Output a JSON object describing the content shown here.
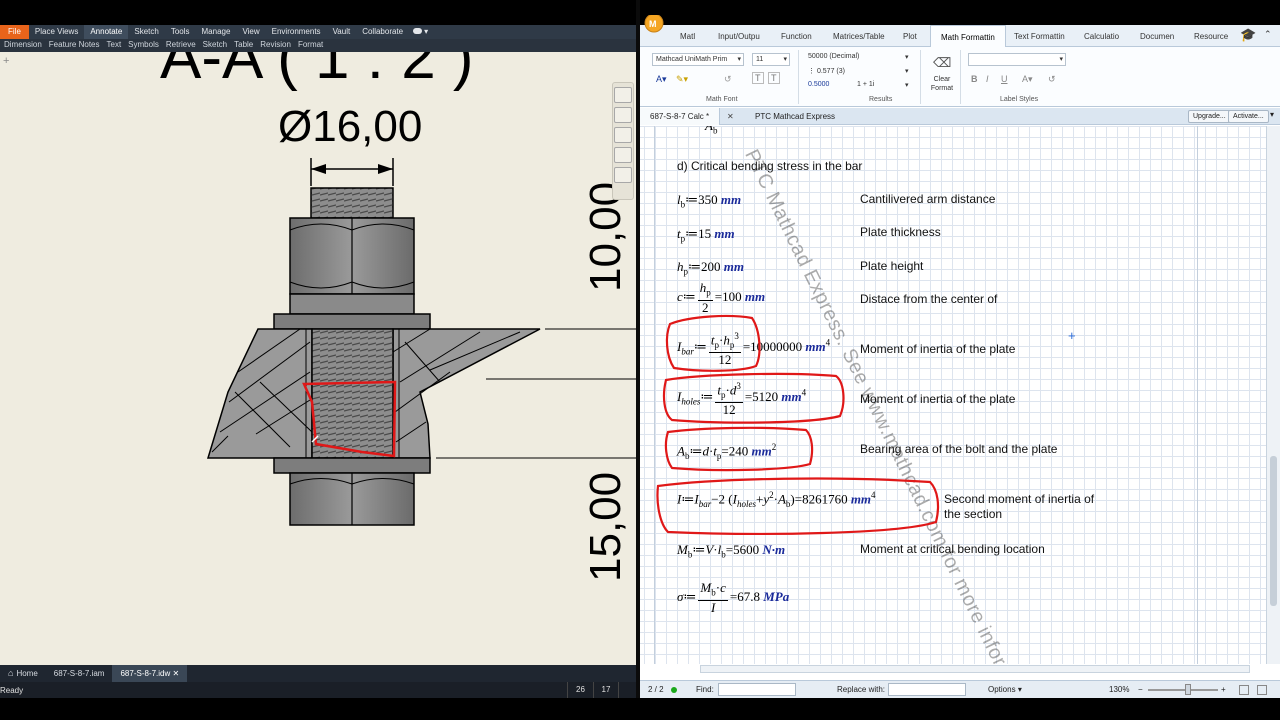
{
  "inventor": {
    "menu": [
      "File",
      "Place Views",
      "Annotate",
      "Sketch",
      "Tools",
      "Manage",
      "View",
      "Environments",
      "Vault",
      "Collaborate"
    ],
    "menu_extra": "▾",
    "submenu": [
      "Dimension",
      "Feature Notes",
      "Text",
      "Symbols",
      "Retrieve",
      "Sketch",
      "Table",
      "Revision",
      "Format"
    ],
    "drawing": {
      "section_title": "A-A ( 1 : 2 )",
      "diameter": "Ø16,00",
      "dim_top": "10,00",
      "dim_bottom": "15,00"
    },
    "tabs": [
      "Home",
      "687-S-8-7.iam",
      "687-S-8-7.idw"
    ],
    "tab_close": "✕",
    "status": {
      "text": "Ready",
      "n1": "26",
      "n2": "17"
    },
    "highlight_color": "#e01818"
  },
  "mathcad": {
    "ribbon_tabs": [
      "Matl",
      "Input/Outpu",
      "Function",
      "Matrices/Table",
      "Plot",
      "Math Formattin",
      "Text Formattin",
      "Calculatio",
      "Documen",
      "Resource"
    ],
    "ribbon": {
      "font_name": "Mathcad UniMath Prim",
      "font_size": "11",
      "result_format": "50000 (Decimal)",
      "result_decimals": "0.577 (3)",
      "result_precision": "0.5000",
      "complex": "1 + 1i",
      "clear_format": "Clear Format",
      "bold": "B",
      "italic": "I",
      "underline": "U",
      "group_font": "Math Font",
      "group_results": "Results",
      "group_labels": "Label Styles"
    },
    "doc_tab": "687-S-8-7 Calc *",
    "doc_tab2": "PTC Mathcad Express",
    "buttons": {
      "upgrade": "Upgrade...",
      "activate": "Activate..."
    },
    "watermark": "PTC Mathcad Express. See www.mathcad.com for more information.",
    "sheet": {
      "top_fragment": "A",
      "heading": "d) Critical bending stress in the bar",
      "rows": [
        {
          "comment": "Cantilivered arm distance"
        },
        {
          "comment": "Plate thickness"
        },
        {
          "comment": "Plate height"
        },
        {
          "comment": "Distace from the center of"
        },
        {
          "comment": "Moment of inertia of the plate"
        },
        {
          "comment": "Moment of inertia of the plate"
        },
        {
          "comment": "Bearing area of the bolt and the plate"
        },
        {
          "comment": "Second moment of inertia of",
          "comment2": "the section"
        },
        {
          "comment": "Moment at critical bending location"
        },
        {
          "comment": ""
        }
      ],
      "values": {
        "lb": "350",
        "tp": "15",
        "hp": "200",
        "c": "100",
        "Ibar": "10000000",
        "Iholes": "5120",
        "Ab": "240",
        "I": "8261760",
        "Mb": "5600",
        "sigma": "67.8"
      }
    },
    "status": {
      "page": "2 / 2",
      "find_label": "Find:",
      "replace_label": "Replace with:",
      "options": "Options",
      "zoom": "130%"
    }
  }
}
